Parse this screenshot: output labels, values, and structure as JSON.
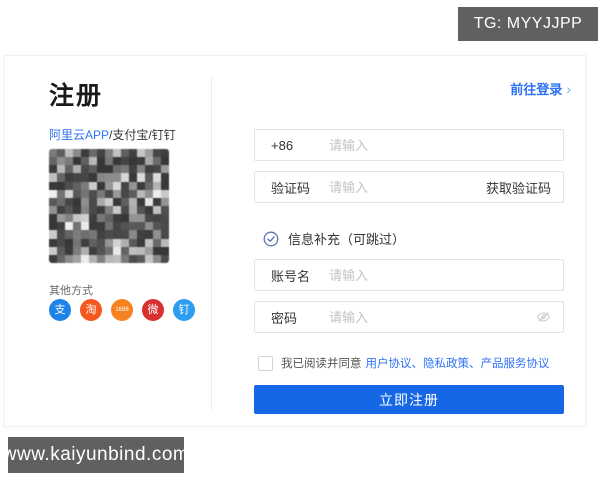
{
  "badges": {
    "tg": "TG: MYYJJPP",
    "site": "www.kaiyunbind.com"
  },
  "card": {
    "title": "注册",
    "login_link": {
      "label": "前往登录",
      "arrow": "›"
    },
    "left": {
      "methods_highlight": "阿里云APP",
      "methods_rest": "/支付宝/钉钉",
      "other_label": "其他方式",
      "social": [
        {
          "name": "alipay",
          "glyph": "支",
          "color": "#1e83e9"
        },
        {
          "name": "taobao",
          "glyph": "淘",
          "color": "#f5571d"
        },
        {
          "name": "1688",
          "glyph": "1688",
          "color": "#f5821f"
        },
        {
          "name": "weibo",
          "glyph": "微",
          "color": "#d8302f"
        },
        {
          "name": "dingtalk",
          "glyph": "钉",
          "color": "#2d9df0"
        }
      ]
    },
    "form": {
      "fields": [
        {
          "label": "+86",
          "placeholder": "请输入"
        },
        {
          "label": "验证码",
          "placeholder": "请输入",
          "action": "获取验证码"
        },
        {
          "label": "账号名",
          "placeholder": "请输入"
        },
        {
          "label": "密码",
          "placeholder": "请输入"
        }
      ],
      "info_note": "信息补充（可跳过）",
      "agreement_prefix": "我已阅读并同意",
      "agreement_links": [
        "用户协议",
        "隐私政策",
        "产品服务协议"
      ],
      "agreement_separator": "、",
      "submit": "立即注册"
    }
  },
  "colors": {
    "accent": "#1667e6",
    "link": "#2e72f5",
    "badge_bg": "#606060"
  }
}
